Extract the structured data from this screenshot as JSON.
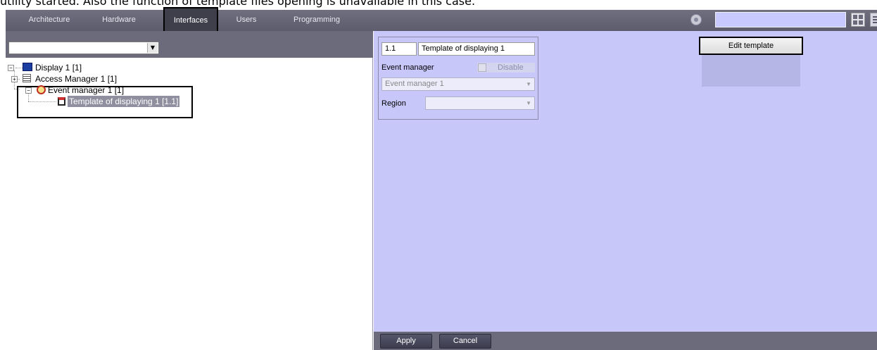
{
  "caption": "utility started. Also the function of template files opening is unavailable in this case.",
  "tabs": [
    "Architecture",
    "Hardware",
    "Interfaces",
    "Users",
    "Programming"
  ],
  "active_tab": "Interfaces",
  "toolbar": {
    "search_value": "",
    "icons": [
      "settings-icon",
      "grid-view-icon",
      "list-view-icon"
    ]
  },
  "left": {
    "combo_value": "",
    "tree": [
      {
        "label": "Display 1 [1]",
        "icon": "monitor-icon",
        "expander": "−"
      },
      {
        "label": "Access Manager 1 [1]",
        "icon": "list-icon",
        "expander": "+"
      },
      {
        "label": "Event manager 1 [1]",
        "icon": "event-magnifier-icon",
        "expander": "−"
      },
      {
        "label": "Template of displaying 1 [1.1]",
        "icon": "template-icon",
        "selected": true
      }
    ]
  },
  "settings": {
    "id_value": "1.1",
    "name_value": "Template of displaying 1",
    "event_manager_label": "Event manager",
    "disable_label": "Disable",
    "event_manager_select": "Event manager 1",
    "region_label": "Region",
    "region_value": ""
  },
  "edit_template_label": "Edit template",
  "buttons": {
    "apply": "Apply",
    "cancel": "Cancel"
  },
  "colors": {
    "panel": "#c7c7f9",
    "header": "#6b6b7b",
    "selection": "#8f8f9f"
  }
}
